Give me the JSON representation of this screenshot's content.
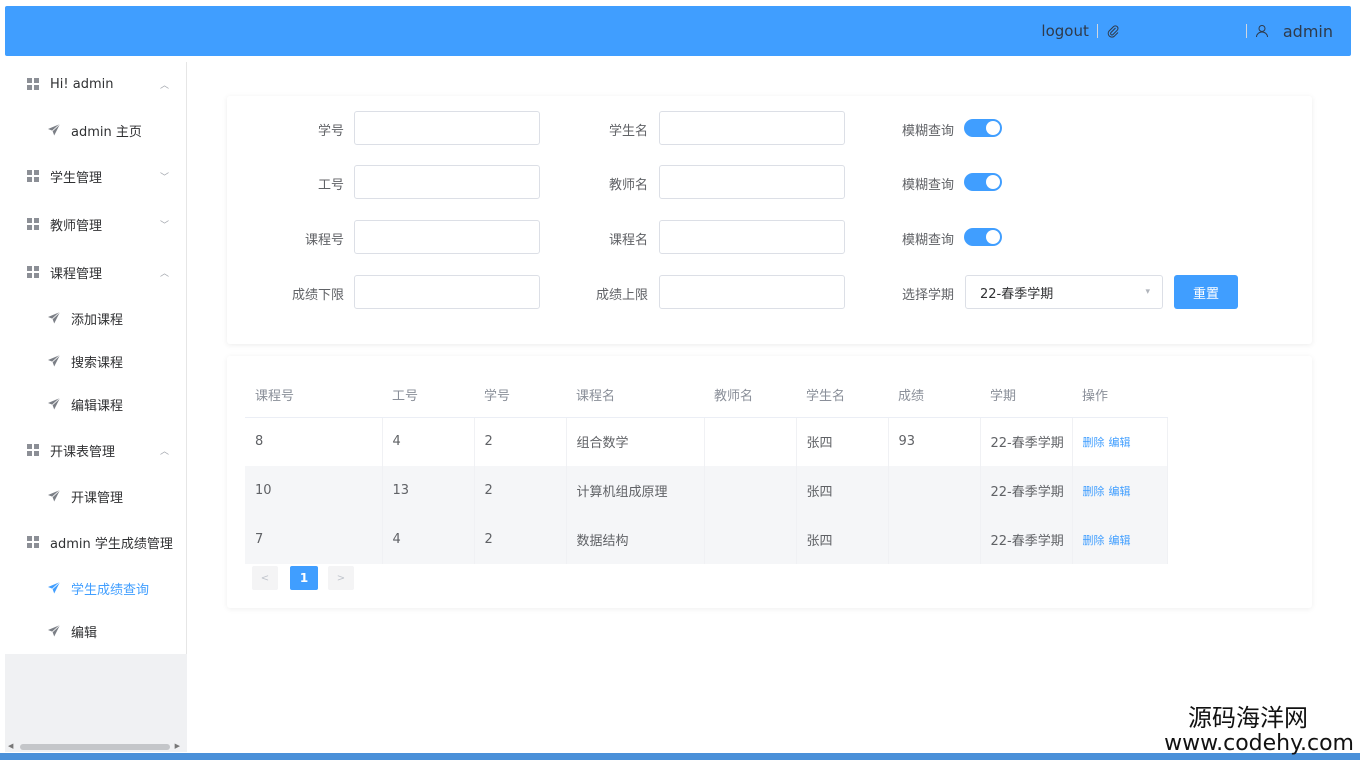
{
  "header": {
    "logout_label": "logout",
    "admin_label": "admin"
  },
  "sidebar": {
    "items": [
      {
        "label": "Hi! admin",
        "type": "group"
      },
      {
        "label": "admin 主页",
        "type": "sub"
      },
      {
        "label": "学生管理",
        "type": "group"
      },
      {
        "label": "教师管理",
        "type": "group"
      },
      {
        "label": "课程管理",
        "type": "group"
      },
      {
        "label": "添加课程",
        "type": "sub"
      },
      {
        "label": "搜索课程",
        "type": "sub"
      },
      {
        "label": "编辑课程",
        "type": "sub"
      },
      {
        "label": "开课表管理",
        "type": "group"
      },
      {
        "label": "开课管理",
        "type": "sub"
      },
      {
        "label": "admin 学生成绩管理",
        "type": "group"
      },
      {
        "label": "学生成绩查询",
        "type": "sub",
        "active": true
      },
      {
        "label": "编辑",
        "type": "sub"
      }
    ]
  },
  "search_form": {
    "student_id_label": "学号",
    "student_name_label": "学生名",
    "fuzzy_label": "模糊查询",
    "teacher_id_label": "工号",
    "teacher_name_label": "教师名",
    "course_id_label": "课程号",
    "course_name_label": "课程名",
    "score_min_label": "成绩下限",
    "score_max_label": "成绩上限",
    "semester_label": "选择学期",
    "semester_value": "22-春季学期",
    "reset_label": "重置",
    "fuzzy_switches": [
      true,
      true,
      true
    ]
  },
  "table": {
    "columns": [
      "课程号",
      "工号",
      "学号",
      "课程名",
      "教师名",
      "学生名",
      "成绩",
      "学期",
      "操作"
    ],
    "rows": [
      [
        "8",
        "4",
        "2",
        "组合数学",
        "",
        "张四",
        "93",
        "22-春季学期"
      ],
      [
        "10",
        "13",
        "2",
        "计算机组成原理",
        "",
        "张四",
        "",
        "22-春季学期"
      ],
      [
        "7",
        "4",
        "2",
        "数据结构",
        "",
        "张四",
        "",
        "22-春季学期"
      ]
    ],
    "delete_label": "删除",
    "edit_label": "编辑"
  },
  "pagination": {
    "prev": "<",
    "current_page": "1",
    "next": ">"
  },
  "watermark": {
    "cn": "源码海洋网",
    "url": "www.codehy.com"
  },
  "colors": {
    "accent": "#409eff",
    "header_bg": "#409eff"
  }
}
